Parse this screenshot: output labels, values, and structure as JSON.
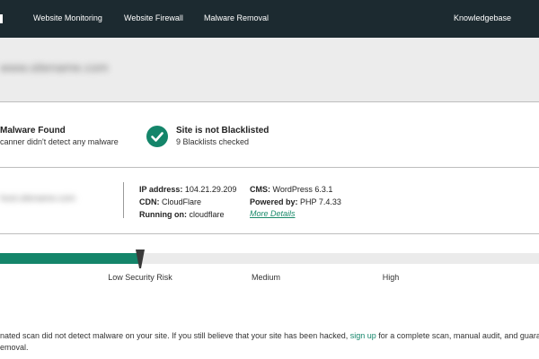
{
  "nav": {
    "items": [
      "Website Monitoring",
      "Website Firewall",
      "Malware Removal"
    ],
    "right_item": "Knowledgebase"
  },
  "url_band": {
    "site_url": "www.sitename.com"
  },
  "malware": {
    "title": "Malware Found",
    "subtitle": "canner didn't detect any malware"
  },
  "blacklist": {
    "title": "Site is not Blacklisted",
    "subtitle": "9 Blacklists checked",
    "icon": "check-circle-icon",
    "color": "#14856a"
  },
  "site_info": {
    "host_blurred": "host.sitename.com",
    "ip_label": "IP address:",
    "ip_value": "104.21.29.209",
    "cdn_label": "CDN:",
    "cdn_value": "CloudFlare",
    "running_label": "Running on:",
    "running_value": "cloudflare",
    "cms_label": "CMS:",
    "cms_value": "WordPress 6.3.1",
    "powered_label": "Powered by:",
    "powered_value": "PHP 7.4.33",
    "more_details": "More Details"
  },
  "risk": {
    "labels": [
      "Low Security Risk",
      "Medium",
      "High"
    ],
    "level": 0.26,
    "fill_color": "#14856a"
  },
  "footer_text": {
    "line1_a": "nated scan did not detect malware on your site. If you still believe that your site has been hacked,",
    "signup": "sign up",
    "line1_b": "for a complete scan, manual audit, and guara",
    "line2": "emoval."
  }
}
